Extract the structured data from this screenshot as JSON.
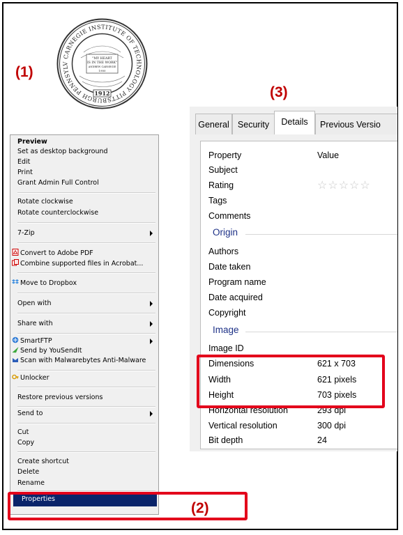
{
  "steps": {
    "one": "(1)",
    "two": "(2)",
    "three": "(3)"
  },
  "seal": {
    "outer_text": "CARNEGIE INSTITUTE OF TECHNOLOGY PITTSBURGH PENNSYLVANIA",
    "motto": [
      "\"MY HEART",
      "IS IN THE WORK\"",
      "ANDREW CARNEGIE",
      "1900"
    ],
    "year": "1912"
  },
  "context_menu": {
    "items": [
      {
        "label": "Preview",
        "bold": true
      },
      {
        "label": "Set as desktop background"
      },
      {
        "label": "Edit"
      },
      {
        "label": "Print"
      },
      {
        "label": "Grant Admin Full Control"
      },
      {
        "label": "Rotate clockwise"
      },
      {
        "label": "Rotate counterclockwise"
      },
      {
        "label": "7-Zip",
        "submenu": true
      },
      {
        "label": "Convert to Adobe PDF",
        "icon": "pdf-icon"
      },
      {
        "label": "Combine supported files in Acrobat...",
        "icon": "acrobat-icon"
      },
      {
        "label": "Move to Dropbox",
        "icon": "dropbox-icon"
      },
      {
        "label": "Open with",
        "submenu": true
      },
      {
        "label": "Share with",
        "submenu": true
      },
      {
        "label": "SmartFTP",
        "icon": "smartftp-icon",
        "submenu": true
      },
      {
        "label": "Send by YouSendIt",
        "icon": "yousendit-icon"
      },
      {
        "label": "Scan with Malwarebytes Anti-Malware",
        "icon": "malwarebytes-icon"
      },
      {
        "label": "Unlocker",
        "icon": "unlocker-icon"
      },
      {
        "label": "Restore previous versions"
      },
      {
        "label": "Send to",
        "submenu": true
      },
      {
        "label": "Cut"
      },
      {
        "label": "Copy"
      },
      {
        "label": "Create shortcut"
      },
      {
        "label": "Delete"
      },
      {
        "label": "Rename"
      },
      {
        "label": "Properties",
        "selected": true
      }
    ]
  },
  "dialog": {
    "tabs": [
      "General",
      "Security",
      "Details",
      "Previous Versio"
    ],
    "active_tab": "Details",
    "header": {
      "property": "Property",
      "value": "Value"
    },
    "rows": {
      "subject": "Subject",
      "rating": "Rating",
      "tags": "Tags",
      "comments": "Comments",
      "origin": "Origin",
      "authors": "Authors",
      "date_taken": "Date taken",
      "program_name": "Program name",
      "date_acquired": "Date acquired",
      "copyright": "Copyright",
      "image": "Image",
      "image_id": "Image ID",
      "dimensions": "Dimensions",
      "dimensions_value": "621 x 703",
      "width": "Width",
      "width_value": "621 pixels",
      "height": "Height",
      "height_value": "703 pixels",
      "horizontal_resolution": "Horizontal resolution",
      "horizontal_resolution_value": "293 dpi",
      "vertical_resolution": "Vertical resolution",
      "vertical_resolution_value": "300 dpi",
      "bit_depth": "Bit depth",
      "bit_depth_value": "24"
    },
    "rating_stars": "☆☆☆☆☆"
  },
  "colors": {
    "highlight": "#e3001b",
    "step_label": "#c00000",
    "menu_selection": "#0a246a",
    "group_header": "#1e3287"
  }
}
